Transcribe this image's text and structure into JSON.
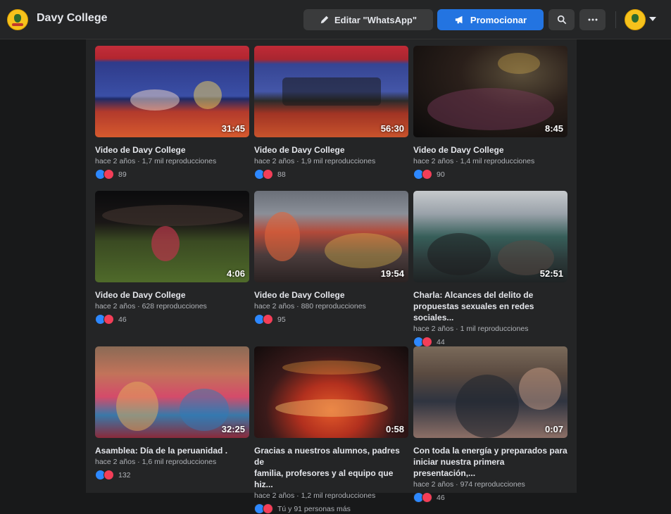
{
  "header": {
    "page_name": "Davy College",
    "edit_button": "Editar \"WhatsApp\"",
    "promote_button": "Promocionar"
  },
  "icons": {
    "logo": "davy-college-logo",
    "edit": "pencil-icon",
    "promote": "megaphone-icon",
    "search": "search-icon",
    "more": "more-icon",
    "account": "account-avatar",
    "dropdown": "caret-down-icon"
  },
  "colors": {
    "accent": "#2374e1",
    "like": "#2d88ff",
    "love": "#f33e58",
    "background": "#18191a",
    "panel": "#242526"
  },
  "videos": [
    {
      "duration": "31:45",
      "title": "Video de Davy College",
      "age": "hace 2 años",
      "views": "1,7 mil reproducciones",
      "reactions": "89"
    },
    {
      "duration": "56:30",
      "title": "Video de Davy College",
      "age": "hace 2 años",
      "views": "1,9 mil reproducciones",
      "reactions": "88"
    },
    {
      "duration": "8:45",
      "title": "Video de Davy College",
      "age": "hace 2 años",
      "views": "1,4 mil reproducciones",
      "reactions": "90"
    },
    {
      "duration": "4:06",
      "title": "Video de Davy College",
      "age": "hace 2 años",
      "views": "628 reproducciones",
      "reactions": "46"
    },
    {
      "duration": "19:54",
      "title": "Video de Davy College",
      "age": "hace 2 años",
      "views": "880 reproducciones",
      "reactions": "95"
    },
    {
      "duration": "52:51",
      "title": "Charla: Alcances del delito de\npropuestas sexuales en redes sociales...",
      "age": "hace 2 años",
      "views": "1 mil reproducciones",
      "reactions": "44"
    },
    {
      "duration": "32:25",
      "title": "Asamblea: Día de la peruanidad .",
      "age": "hace 2 años",
      "views": "1,6 mil reproducciones",
      "reactions": "132"
    },
    {
      "duration": "0:58",
      "title": "Gracias a nuestros alumnos, padres de\nfamilia, profesores y al equipo que hiz...",
      "age": "hace 2 años",
      "views": "1,2 mil reproducciones",
      "reactions": "Tú y 91 personas más"
    },
    {
      "duration": "0:07",
      "title": "Con toda la energía y preparados para\niniciar nuestra primera presentación,...",
      "age": "hace 2 años",
      "views": "974 reproducciones",
      "reactions": "46"
    }
  ]
}
